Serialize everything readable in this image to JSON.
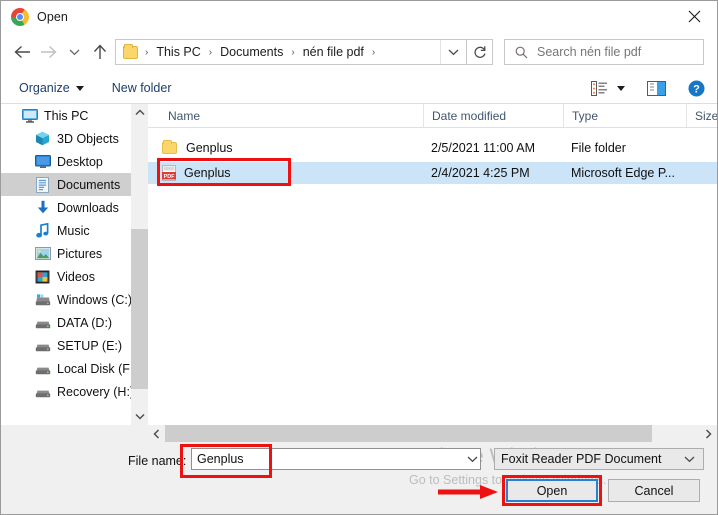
{
  "window": {
    "title": "Open",
    "icon": "chrome-icon",
    "close_label": "close-icon"
  },
  "navigation": {
    "back": "back-arrow-icon",
    "forward": "forward-arrow-icon",
    "recent": "chevron-down-icon",
    "up": "up-arrow-icon",
    "breadcrumbs": [
      "This PC",
      "Documents",
      "nén file pdf"
    ],
    "breadcrumb_separator": "›",
    "dropdown": "chevron-down-icon",
    "refresh": "refresh-icon"
  },
  "search": {
    "placeholder": "Search nén file pdf",
    "icon": "search-icon"
  },
  "toolbar": {
    "organize": "Organize",
    "new_folder": "New folder",
    "view_icon": "view-list-icon",
    "pane_icon": "preview-pane-icon",
    "help_icon": "help-icon"
  },
  "sidebar": {
    "items": [
      {
        "label": "This PC",
        "icon": "computer-icon",
        "level": 0,
        "selected": false
      },
      {
        "label": "3D Objects",
        "icon": "3d-objects-icon",
        "level": 1,
        "selected": false
      },
      {
        "label": "Desktop",
        "icon": "desktop-icon",
        "level": 1,
        "selected": false
      },
      {
        "label": "Documents",
        "icon": "documents-icon",
        "level": 1,
        "selected": true
      },
      {
        "label": "Downloads",
        "icon": "downloads-icon",
        "level": 1,
        "selected": false
      },
      {
        "label": "Music",
        "icon": "music-icon",
        "level": 1,
        "selected": false
      },
      {
        "label": "Pictures",
        "icon": "pictures-icon",
        "level": 1,
        "selected": false
      },
      {
        "label": "Videos",
        "icon": "videos-icon",
        "level": 1,
        "selected": false
      },
      {
        "label": "Windows (C:)",
        "icon": "os-drive-icon",
        "level": 1,
        "selected": false
      },
      {
        "label": "DATA (D:)",
        "icon": "drive-icon",
        "level": 1,
        "selected": false
      },
      {
        "label": "SETUP (E:)",
        "icon": "drive-icon",
        "level": 1,
        "selected": false
      },
      {
        "label": "Local Disk (F:)",
        "icon": "drive-icon",
        "level": 1,
        "selected": false
      },
      {
        "label": "Recovery (H:)",
        "icon": "drive-icon",
        "level": 1,
        "selected": false
      }
    ]
  },
  "filelist": {
    "columns": [
      "Name",
      "Date modified",
      "Type",
      "Size"
    ],
    "sort_column": "Name",
    "sort_direction": "ascending",
    "rows": [
      {
        "name": "Genplus",
        "date_modified": "2/5/2021 11:00 AM",
        "type": "File folder",
        "size": "",
        "icon": "folder-icon",
        "selected": false
      },
      {
        "name": "Genplus",
        "date_modified": "2/4/2021 4:25 PM",
        "type": "Microsoft Edge P...",
        "size": "",
        "icon": "pdf-file-icon",
        "selected": true
      }
    ]
  },
  "footer": {
    "filename_label": "File name:",
    "filename_value": "Genplus",
    "filetype_value": "Foxit Reader PDF Document",
    "open_label": "Open",
    "cancel_label": "Cancel"
  },
  "watermark": {
    "line1": "Activate Windows",
    "line2": "Go to Settings to activate Windows."
  },
  "annotations": {
    "color": "#ee1111",
    "highlight_pdf_row": true,
    "highlight_filename_field": true,
    "highlight_open_button": true,
    "arrow_to_open_button": true
  },
  "colors": {
    "selection_blue": "#cce4f7",
    "focus_blue": "#2a7fd4",
    "annotation_red": "#ee1111",
    "panel_gray": "#f0f0f0",
    "watermark_gray": "#bdbdbd"
  }
}
